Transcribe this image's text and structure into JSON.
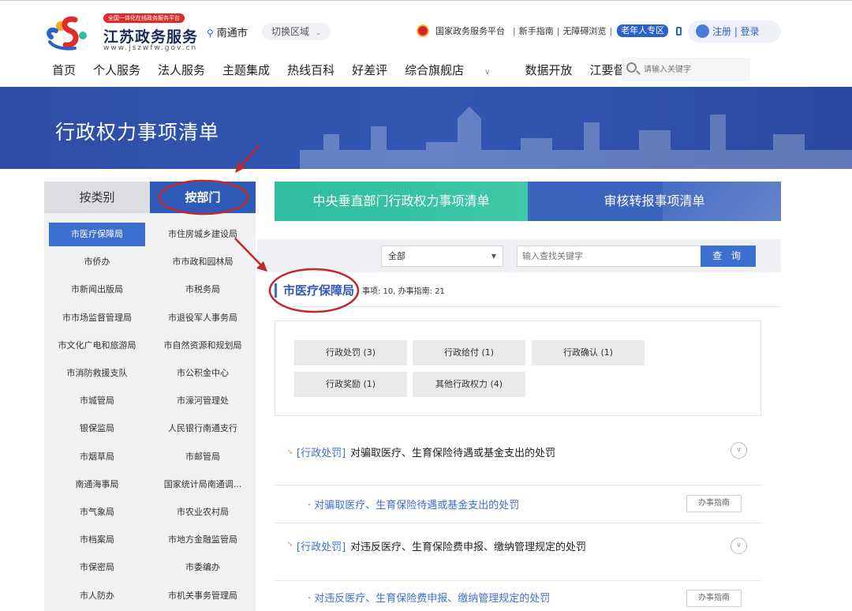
{
  "header": {
    "slogan": "全国一体化在线政务服务平台",
    "site_name": "江苏政务服务",
    "site_url": "www.jszwfw.gov.cn",
    "city": "南通市",
    "switch_region": "切换区域",
    "top_links": {
      "national_platform": "国家政务服务平台",
      "beginner_guide": "新手指南",
      "accessible": "无障碍浏览",
      "elder_zone": "老年人专区"
    },
    "login": "注册 | 登录",
    "nav": [
      "首页",
      "个人服务",
      "法人服务",
      "主题集成",
      "热线百科",
      "好差评",
      "综合旗舰店",
      "数据开放",
      "江要督"
    ],
    "search_placeholder": "请输入关键字"
  },
  "banner": {
    "title": "行政权力事项清单"
  },
  "sidebar": {
    "tab_by_category": "按类别",
    "tab_by_department": "按部门",
    "departments": [
      "市医疗保障局",
      "市住房城乡建设局",
      "市侨办",
      "市市政和园林局",
      "市新闻出版局",
      "市税务局",
      "市市场监督管理局",
      "市退役军人事务局",
      "市文化广电和旅游局",
      "市自然资源和规划局",
      "市消防救援支队",
      "市公积金中心",
      "市城管局",
      "市濠河管理处",
      "银保监局",
      "人民银行南通支行",
      "市烟草局",
      "市邮管局",
      "南通海事局",
      "国家统计局南通调...",
      "市气象局",
      "市农业农村局",
      "市档案局",
      "市地方金融监管局",
      "市保密局",
      "市委编办",
      "市人防办",
      "市机关事务管理局"
    ],
    "active_department": "市医疗保障局"
  },
  "main": {
    "tab_central": "中央垂直部门行政权力事项清单",
    "tab_review": "审核转报事项清单",
    "filter": {
      "select_value": "全部",
      "input_placeholder": "输入查找关键字",
      "button": "查 询"
    },
    "department_heading": "市医疗保障局",
    "department_stats": "事项: 10, 办事指南: 21",
    "categories": [
      "行政处罚 (3)",
      "行政给付 (1)",
      "行政确认 (1)",
      "行政奖励 (1)",
      "其他行政权力 (4)"
    ],
    "items": [
      {
        "type": "[行政处罚]",
        "title": "对骗取医疗、生育保险待遇或基金支出的处罚",
        "sub_title": "· 对骗取医疗、生育保险待遇或基金支出的处罚",
        "guide": "办事指南"
      },
      {
        "type": "[行政处罚]",
        "title": "对违反医疗、生育保险费申报、缴纳管理规定的处罚",
        "sub_title": "· 对违反医疗、生育保险费申报、缴纳管理规定的处罚",
        "guide": "办事指南"
      }
    ]
  },
  "colors": {
    "primary_blue": "#2e5bb8",
    "teal": "#2ebd9d",
    "annotation_red": "#c0282a"
  }
}
